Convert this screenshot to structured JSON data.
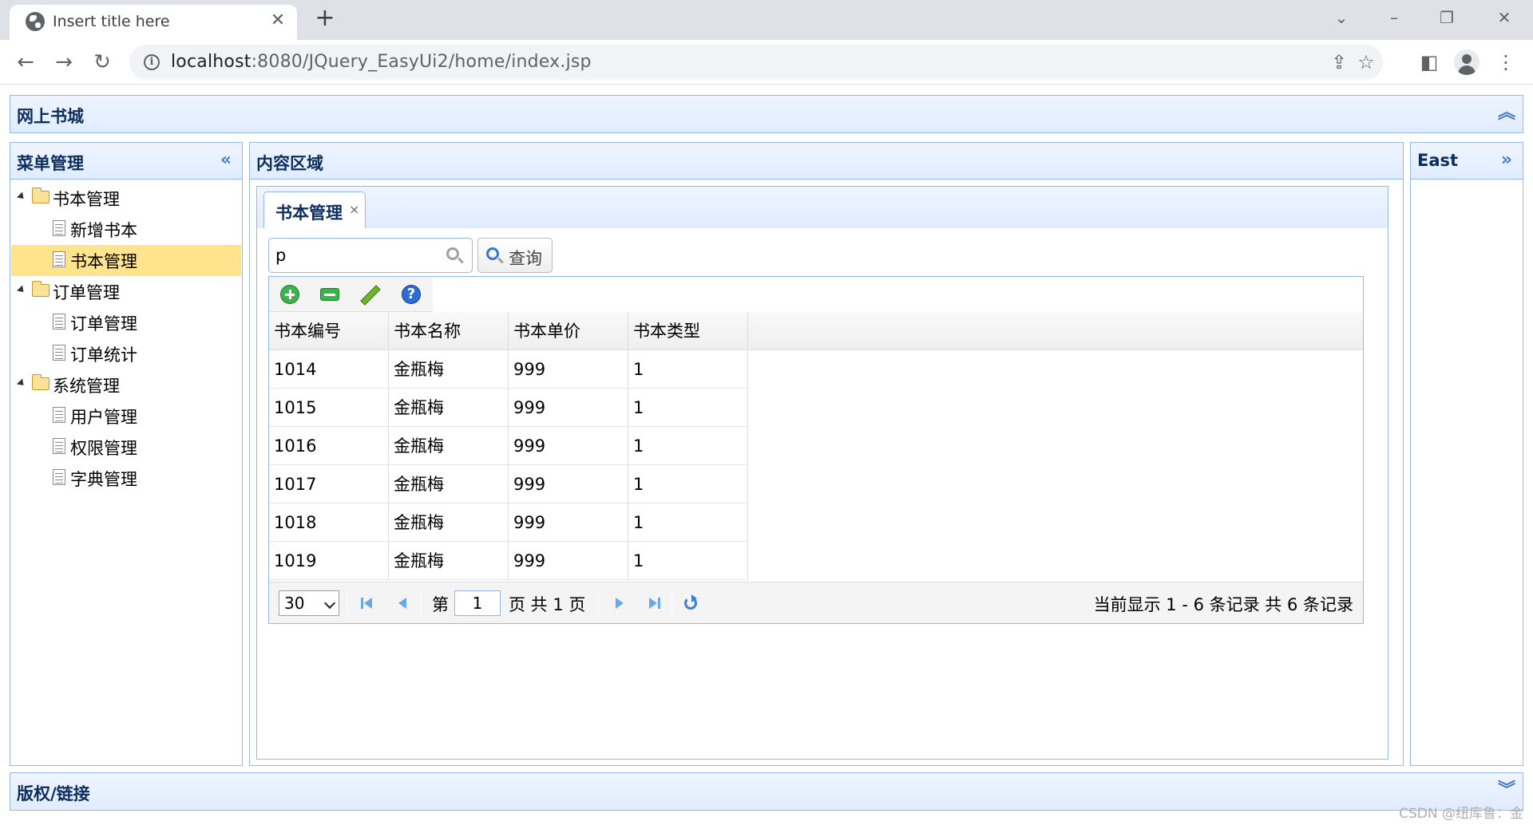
{
  "browser": {
    "tab_title": "Insert title here",
    "tab_close": "✕",
    "new_tab": "+",
    "url_host": "localhost",
    "url_path": ":8080/JQuery_EasyUi2/home/index.jsp",
    "info": "i"
  },
  "north": {
    "title": "网上书城"
  },
  "west": {
    "title": "菜单管理",
    "tree": [
      {
        "label": "书本管理",
        "type": "folder"
      },
      {
        "label": "新增书本",
        "type": "file"
      },
      {
        "label": "书本管理",
        "type": "file",
        "selected": true
      },
      {
        "label": "订单管理",
        "type": "folder"
      },
      {
        "label": "订单管理",
        "type": "file"
      },
      {
        "label": "订单统计",
        "type": "file"
      },
      {
        "label": "系统管理",
        "type": "folder"
      },
      {
        "label": "用户管理",
        "type": "file"
      },
      {
        "label": "权限管理",
        "type": "file"
      },
      {
        "label": "字典管理",
        "type": "file"
      }
    ]
  },
  "center": {
    "title": "内容区域",
    "tab": {
      "label": "书本管理",
      "close": "×"
    },
    "search": {
      "value": "p"
    },
    "query_button": "查询",
    "help_glyph": "?",
    "grid": {
      "columns": [
        "书本编号",
        "书本名称",
        "书本单价",
        "书本类型"
      ],
      "rows": [
        [
          "1014",
          "金瓶梅",
          "999",
          "1"
        ],
        [
          "1015",
          "金瓶梅",
          "999",
          "1"
        ],
        [
          "1016",
          "金瓶梅",
          "999",
          "1"
        ],
        [
          "1017",
          "金瓶梅",
          "999",
          "1"
        ],
        [
          "1018",
          "金瓶梅",
          "999",
          "1"
        ],
        [
          "1019",
          "金瓶梅",
          "999",
          "1"
        ]
      ]
    },
    "pager": {
      "page_size": "30",
      "before_label": "第",
      "page": "1",
      "after_label": "页 共 1 页",
      "info": "当前显示 1 - 6 条记录 共 6 条记录"
    }
  },
  "east": {
    "title": "East"
  },
  "south": {
    "title": "版权/链接"
  },
  "watermark": "CSDN @纽库鲁：金"
}
